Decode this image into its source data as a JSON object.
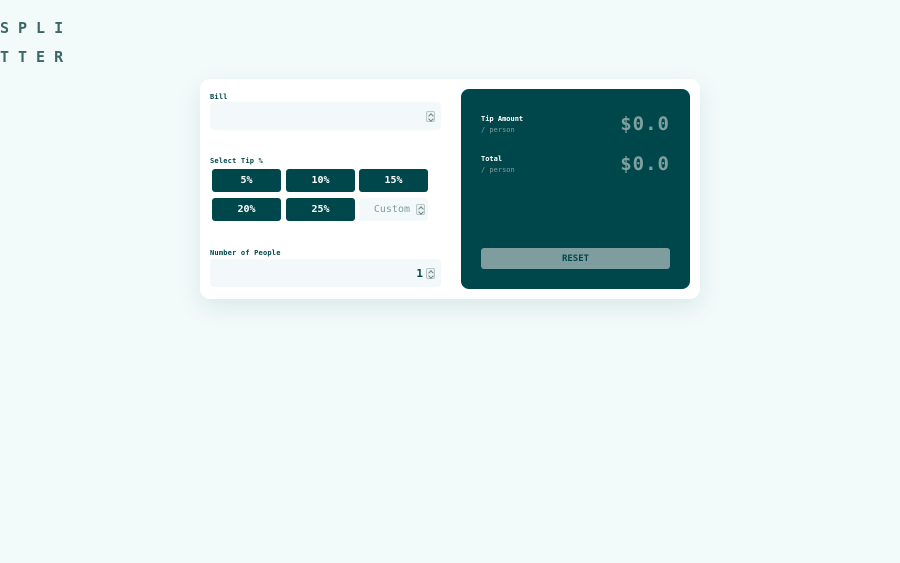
{
  "logo": {
    "line1": "SPLI",
    "line2": "TTER"
  },
  "bill": {
    "label": "Bill",
    "value": ""
  },
  "tip": {
    "label": "Select Tip %",
    "options": [
      "5%",
      "10%",
      "15%",
      "20%",
      "25%"
    ],
    "custom_placeholder": "Custom"
  },
  "people": {
    "label": "Number of People",
    "value": "1"
  },
  "results": {
    "tip_title": "Tip Amount",
    "tip_sub": "/ person",
    "tip_value": "$0.0",
    "total_title": "Total",
    "total_sub": "/ person",
    "total_value": "$0.0",
    "reset_label": "RESET"
  },
  "colors": {
    "background": "#f3fafa",
    "primary": "#00474b",
    "muted": "#7f9d9f",
    "input_bg": "#f3f9fa"
  }
}
